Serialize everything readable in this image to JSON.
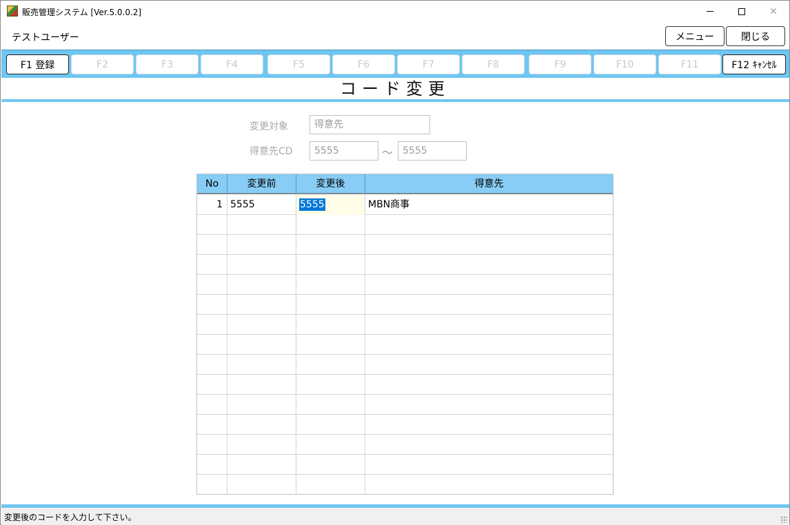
{
  "window": {
    "title": "販売管理システム [Ver.5.0.0.2]",
    "minimize_glyph": "",
    "close_glyph": "✕"
  },
  "header": {
    "user_name": "テストユーザー",
    "menu_label": "メニュー",
    "close_label": "閉じる"
  },
  "function_keys": [
    {
      "label": "F1 登録",
      "enabled": true
    },
    {
      "label": "F2",
      "enabled": false
    },
    {
      "label": "F3",
      "enabled": false
    },
    {
      "label": "F4",
      "enabled": false
    },
    {
      "label": "F5",
      "enabled": false
    },
    {
      "label": "F6",
      "enabled": false
    },
    {
      "label": "F7",
      "enabled": false
    },
    {
      "label": "F8",
      "enabled": false
    },
    {
      "label": "F9",
      "enabled": false
    },
    {
      "label": "F10",
      "enabled": false
    },
    {
      "label": "F11",
      "enabled": false
    },
    {
      "label": "F12 ｷｬﾝｾﾙ",
      "enabled": true
    }
  ],
  "screen_title": "コード変更",
  "filters": {
    "target_label": "変更対象",
    "target_value": "得意先",
    "range_label": "得意先CD",
    "range_from": "5555",
    "range_separator": "～",
    "range_to": "5555"
  },
  "grid": {
    "columns": [
      "No",
      "変更前",
      "変更後",
      "得意先"
    ],
    "rows": [
      {
        "no": "1",
        "before": "5555",
        "after": "5555",
        "customer": "MBN商事"
      }
    ],
    "total_visible_rows": 15
  },
  "status_bar": {
    "message": "変更後のコードを入力して下さい。"
  },
  "colors": {
    "accent_bar": "#6ec6f2",
    "grid_header": "#87cdf5",
    "selection": "#0078d7",
    "edit_cell": "#fffde8"
  }
}
